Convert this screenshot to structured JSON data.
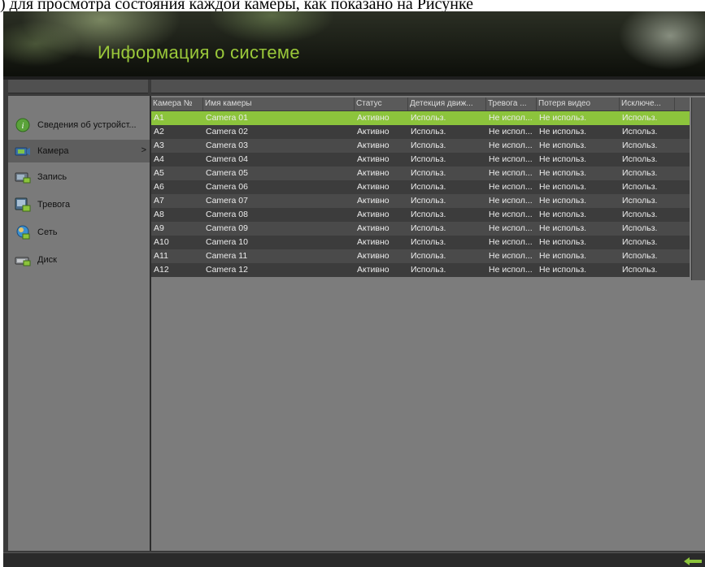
{
  "caption": ") для просмотра состояния каждой камеры, как показано на Рисунке",
  "header": {
    "title": "Информация о системе"
  },
  "sidebar": {
    "items": [
      {
        "label": "Сведения об устройст...",
        "icon": "info-icon",
        "active": false
      },
      {
        "label": "Камера",
        "icon": "camera-icon",
        "active": true,
        "arrow": ">"
      },
      {
        "label": "Запись",
        "icon": "record-icon",
        "active": false
      },
      {
        "label": "Тревога",
        "icon": "alarm-icon",
        "active": false
      },
      {
        "label": "Сеть",
        "icon": "network-icon",
        "active": false
      },
      {
        "label": "Диск",
        "icon": "disk-icon",
        "active": false
      }
    ]
  },
  "table": {
    "columns": [
      "Камера №",
      "Имя камеры",
      "Статус",
      "Детекция движ...",
      "Тревога ...",
      "Потеря видео",
      "Исключе..."
    ],
    "rows": [
      [
        "A1",
        "Camera 01",
        "Активно",
        "Использ.",
        "Не испол...",
        "Не использ.",
        "Использ."
      ],
      [
        "A2",
        "Camera 02",
        "Активно",
        "Использ.",
        "Не испол...",
        "Не использ.",
        "Использ."
      ],
      [
        "A3",
        "Camera 03",
        "Активно",
        "Использ.",
        "Не испол...",
        "Не использ.",
        "Использ."
      ],
      [
        "A4",
        "Camera 04",
        "Активно",
        "Использ.",
        "Не испол...",
        "Не использ.",
        "Использ."
      ],
      [
        "A5",
        "Camera 05",
        "Активно",
        "Использ.",
        "Не испол...",
        "Не использ.",
        "Использ."
      ],
      [
        "A6",
        "Camera 06",
        "Активно",
        "Использ.",
        "Не испол...",
        "Не использ.",
        "Использ."
      ],
      [
        "A7",
        "Camera 07",
        "Активно",
        "Использ.",
        "Не испол...",
        "Не использ.",
        "Использ."
      ],
      [
        "A8",
        "Camera 08",
        "Активно",
        "Использ.",
        "Не испол...",
        "Не использ.",
        "Использ."
      ],
      [
        "A9",
        "Camera 09",
        "Активно",
        "Использ.",
        "Не испол...",
        "Не использ.",
        "Использ."
      ],
      [
        "A10",
        "Camera 10",
        "Активно",
        "Использ.",
        "Не испол...",
        "Не использ.",
        "Использ."
      ],
      [
        "A11",
        "Camera 11",
        "Активно",
        "Использ.",
        "Не испол...",
        "Не использ.",
        "Использ."
      ],
      [
        "A12",
        "Camera 12",
        "Активно",
        "Использ.",
        "Не испол...",
        "Не использ.",
        "Использ."
      ]
    ],
    "selected_row": 0
  },
  "footer": {
    "back_icon": "back-arrow-icon"
  },
  "colors": {
    "accent": "#8cc43c",
    "title": "#9bc93a"
  }
}
